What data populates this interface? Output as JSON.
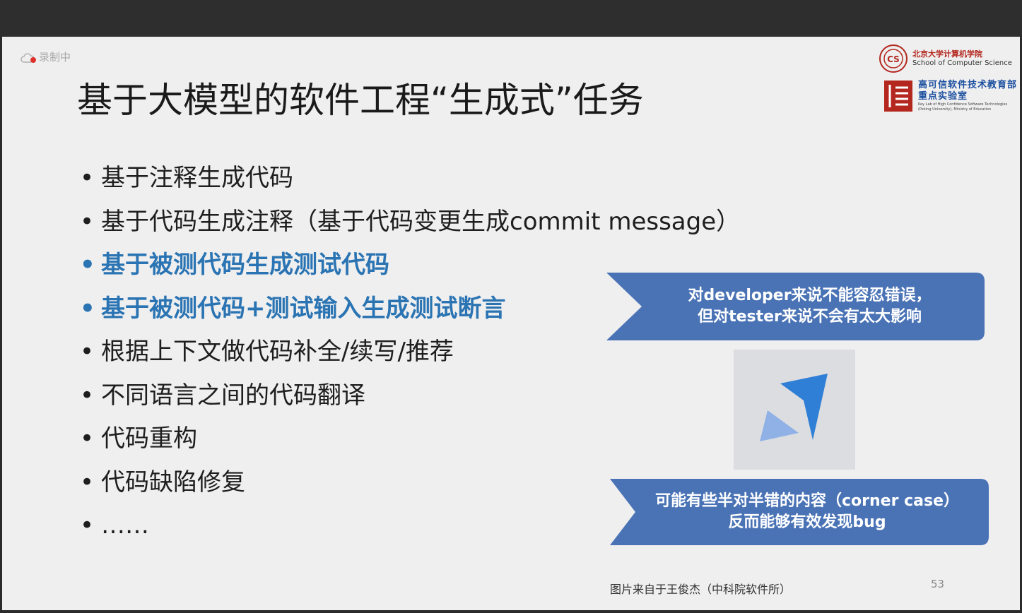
{
  "recording": {
    "label": "录制中"
  },
  "logos": {
    "pku_cn": "北京大学计算机学院",
    "pku_en": "School of Computer Science",
    "lab_cn": "高可信软件技术教育部重点实验室",
    "lab_en": "Key Lab of High Confidence Software Technologies (Peking University), Ministry of Education"
  },
  "slide": {
    "title": "基于大模型的软件工程“生成式”任务",
    "bullets": [
      {
        "text": "基于注释生成代码",
        "highlight": false
      },
      {
        "text": "基于代码生成注释（基于代码变更生成commit message）",
        "highlight": false
      },
      {
        "text": "基于被测代码生成测试代码",
        "highlight": true
      },
      {
        "text": "基于被测代码+测试输入生成测试断言",
        "highlight": true
      },
      {
        "text": "根据上下文做代码补全/续写/推荐",
        "highlight": false
      },
      {
        "text": "不同语言之间的代码翻译",
        "highlight": false
      },
      {
        "text": "代码重构",
        "highlight": false
      },
      {
        "text": "代码缺陷修复",
        "highlight": false
      },
      {
        "text": "……",
        "highlight": false
      }
    ],
    "bullet_char": "•",
    "callout_top": {
      "line1": "对developer来说不能容忍错误，",
      "line2": "但对tester来说不会有太大影响"
    },
    "callout_bottom": {
      "line1": "可能有些半对半错的内容（corner case）",
      "line2": "反而能够有效发现bug"
    },
    "caption": "图片来自于王俊杰（中科院软件所）",
    "page_number": "53"
  },
  "colors": {
    "highlight": "#2b74b3",
    "callout_fill": "#4a73b6",
    "icon_dark": "#2f7fd6",
    "icon_light": "#8fb1e6"
  }
}
